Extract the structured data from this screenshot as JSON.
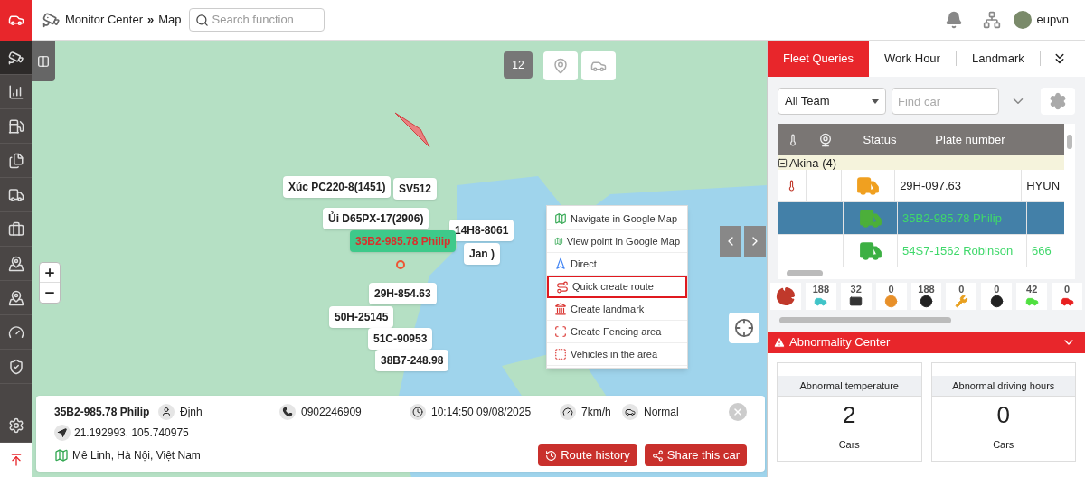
{
  "header": {
    "breadcrumb": [
      "Monitor Center",
      "»",
      "Map"
    ],
    "search": {
      "placeholder": "Search function"
    },
    "user": "eupvn"
  },
  "sidebar": {
    "items": [
      {
        "kind": "camera",
        "selected": true
      },
      {
        "kind": "chart",
        "selected": false
      },
      {
        "kind": "fuel",
        "selected": false
      },
      {
        "kind": "files",
        "selected": false
      },
      {
        "kind": "truck",
        "selected": false
      },
      {
        "kind": "briefcase",
        "selected": false
      },
      {
        "kind": "route",
        "selected": false
      },
      {
        "kind": "route",
        "selected": false
      },
      {
        "kind": "gauge",
        "selected": false
      },
      {
        "kind": "shield",
        "selected": false
      },
      {
        "kind": "settings",
        "selected": false
      }
    ]
  },
  "map": {
    "cluster_count": "12",
    "labels": [
      {
        "text": "Xúc PC220-8(1451)",
        "selected": false
      },
      {
        "text": "SV512",
        "selected": false
      },
      {
        "text": "Ủi D65PX-17(2906)",
        "selected": false
      },
      {
        "text": "14H8-8061",
        "selected": false
      },
      {
        "text": "Jan )",
        "selected": false
      },
      {
        "text": "35B2-985.78 Philip",
        "selected": true
      },
      {
        "text": "29H-854.63",
        "selected": false
      },
      {
        "text": "50H-25145",
        "selected": false
      },
      {
        "text": "51C-90953",
        "selected": false
      },
      {
        "text": "38B7-248.98",
        "selected": false
      }
    ],
    "context_menu": [
      {
        "kind": "gmap",
        "label": "Navigate in Google Map",
        "selected": false
      },
      {
        "kind": "gmap",
        "label": "View point in Google Map",
        "selected": false
      },
      {
        "kind": "direct",
        "label": "Direct",
        "selected": false
      },
      {
        "kind": "route",
        "label": "Quick create route",
        "selected": true
      },
      {
        "kind": "landmark",
        "label": "Create landmark",
        "selected": false
      },
      {
        "kind": "fence",
        "label": "Create Fencing area",
        "selected": false
      },
      {
        "kind": "area",
        "label": "Vehicles in the area",
        "selected": false
      }
    ],
    "info": {
      "plate": "35B2-985.78 Philip",
      "driver": "Định",
      "phone": "0902246909",
      "time": "10:14:50 09/08/2025",
      "speed": "7km/h",
      "status": "Normal",
      "coords": "21.192993, 105.740975",
      "address": "Mê Linh, Hà Nội, Việt Nam",
      "buttons": [
        "Route history",
        "Share this car"
      ]
    }
  },
  "panel": {
    "tabs": [
      {
        "label": "Fleet Queries",
        "selected": true
      },
      {
        "label": "Work Hour",
        "selected": false
      },
      {
        "label": "Landmark",
        "selected": false
      }
    ],
    "team_select": "All Team",
    "find": {
      "placeholder": "Find car"
    },
    "columns": [
      "Status",
      "Plate number"
    ],
    "group": "Akina (4)",
    "rows": [
      {
        "thermometer": true,
        "color": "#f0a020",
        "plate": "29H-097.63",
        "moving": false,
        "selected": false,
        "column_5": "HYUN"
      },
      {
        "thermometer": false,
        "color": "#4caf3a",
        "plate": "35B2-985.78 Philip",
        "moving": true,
        "selected": true,
        "column_5": ""
      },
      {
        "thermometer": false,
        "color": "#3cb043",
        "plate": "54S7-1562 Robinson",
        "moving": true,
        "selected": false,
        "column_5": "666"
      }
    ],
    "counters": [
      {
        "kind": "car",
        "count": "188",
        "color": "#40c4c8"
      },
      {
        "kind": "card",
        "count": "32",
        "color": "#333333"
      },
      {
        "kind": "wheel",
        "count": "0",
        "color": "#e8902a"
      },
      {
        "kind": "wheel",
        "count": "188",
        "color": "#222222"
      },
      {
        "kind": "tool",
        "count": "0",
        "color": "#e8a020"
      },
      {
        "kind": "disc",
        "count": "0",
        "color": "#222222"
      },
      {
        "kind": "car",
        "count": "42",
        "color": "#50e040"
      },
      {
        "kind": "car",
        "count": "0",
        "color": "#e82020"
      }
    ]
  },
  "abnormality": {
    "title": "Abnormality Center",
    "cards": [
      {
        "label": "Abnormal temperature",
        "value": "2",
        "unit": "Cars"
      },
      {
        "label": "Abnormal driving hours",
        "value": "0",
        "unit": "Cars"
      }
    ]
  }
}
